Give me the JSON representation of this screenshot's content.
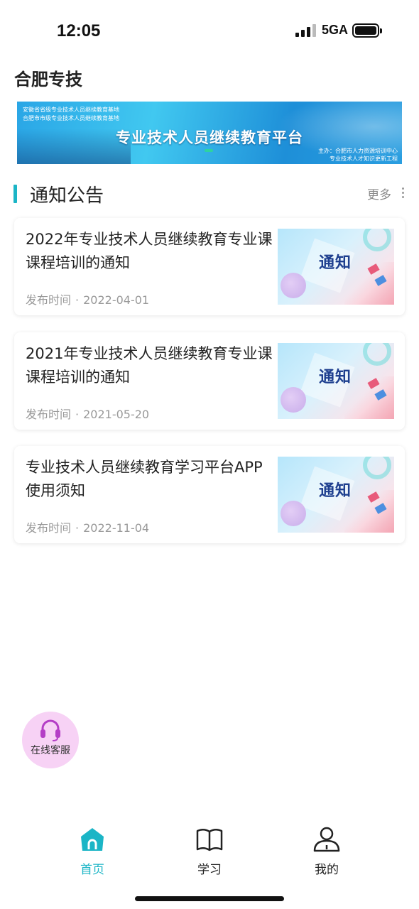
{
  "status_bar": {
    "time": "12:05",
    "network": "5GA"
  },
  "header": {
    "title": "合肥专技"
  },
  "banner": {
    "line1": "安徽省省级专业技术人员继续教育基地",
    "line2": "合肥市市级专业技术人员继续教育基地",
    "main_title": "专业技术人员继续教育平台",
    "host1": "主办：合肥市人力资源培训中心",
    "host2": "专业技术人才知识更新工程"
  },
  "section": {
    "title": "通知公告",
    "more_label": "更多"
  },
  "notices": [
    {
      "title": "2022年专业技术人员继续教育专业课课程培训的通知",
      "meta_label": "发布时间",
      "date": "2022-04-01",
      "thumb_text": "通知"
    },
    {
      "title": "2021年专业技术人员继续教育专业课课程培训的通知",
      "meta_label": "发布时间",
      "date": "2021-05-20",
      "thumb_text": "通知"
    },
    {
      "title": "专业技术人员继续教育学习平台APP使用须知",
      "meta_label": "发布时间",
      "date": "2022-11-04",
      "thumb_text": "通知"
    }
  ],
  "service": {
    "label": "在线客服"
  },
  "tabbar": {
    "items": [
      {
        "label": "首页",
        "icon": "home-icon",
        "active": true
      },
      {
        "label": "学习",
        "icon": "book-icon",
        "active": false
      },
      {
        "label": "我的",
        "icon": "user-icon",
        "active": false
      }
    ]
  },
  "colors": {
    "accent": "#1bb5c6",
    "service_bg": "#f7d2f5"
  }
}
